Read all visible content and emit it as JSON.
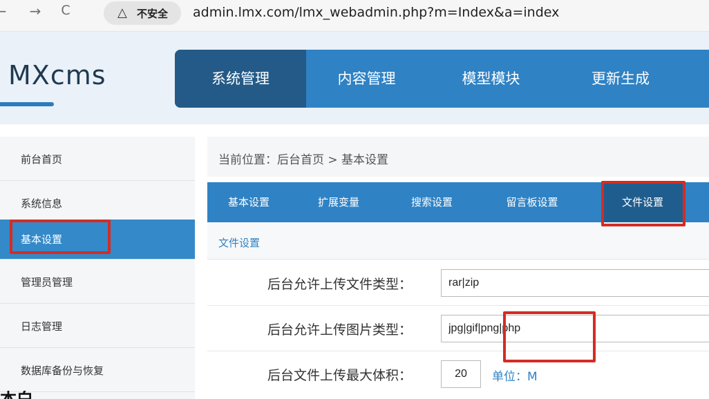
{
  "browser": {
    "back_icon": "←",
    "forward_icon": "→",
    "reload_icon": "C",
    "warning_icon": "△",
    "security_label": "不安全",
    "url": "admin.lmx.com/lmx_webadmin.php?m=Index&a=index"
  },
  "header": {
    "logo": "MXcms",
    "tabs": [
      {
        "label": "系统管理",
        "active": true
      },
      {
        "label": "内容管理",
        "active": false
      },
      {
        "label": "模型模块",
        "active": false
      },
      {
        "label": "更新生成",
        "active": false
      }
    ]
  },
  "sidebar": {
    "items": [
      {
        "label": "前台首页",
        "active": false
      },
      {
        "label": "系统信息",
        "active": false
      },
      {
        "label": "基本设置",
        "active": true
      },
      {
        "label": "管理员管理",
        "active": false
      },
      {
        "label": "日志管理",
        "active": false
      },
      {
        "label": "数据库备份与恢复",
        "active": false
      }
    ]
  },
  "main": {
    "breadcrumb": "当前位置：后台首页  >  基本设置",
    "subtabs": [
      {
        "label": "基本设置",
        "active": false
      },
      {
        "label": "扩展变量",
        "active": false
      },
      {
        "label": "搜索设置",
        "active": false
      },
      {
        "label": "留言板设置",
        "active": false
      },
      {
        "label": "文件设置",
        "active": true
      }
    ],
    "section_title": "文件设置",
    "fields": [
      {
        "label": "后台允许上传文件类型：",
        "value": "rar|zip"
      },
      {
        "label": "后台允许上传图片类型：",
        "value": "jpg|gif|png|php"
      },
      {
        "label": "后台文件上传最大体积：",
        "value": "20",
        "unit": "单位：M"
      }
    ]
  },
  "bottom_fragment": "本白"
}
